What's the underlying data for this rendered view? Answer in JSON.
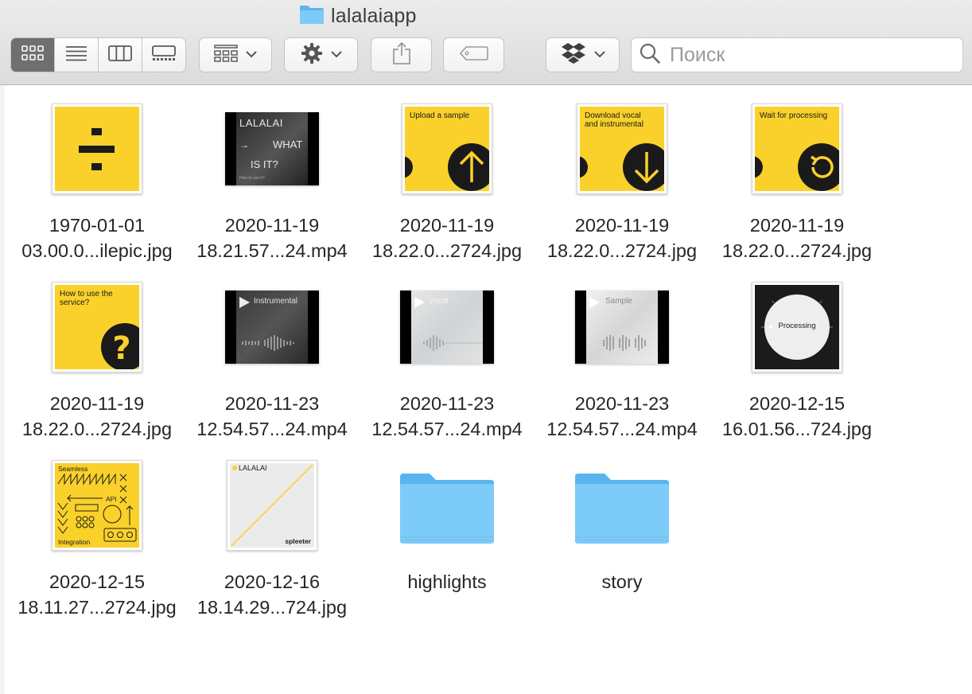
{
  "window": {
    "title": "lalalaiapp"
  },
  "toolbar": {
    "view_modes": [
      "icon-view",
      "list-view",
      "column-view",
      "gallery-view"
    ],
    "active_view": "icon-view",
    "search_placeholder": "Поиск"
  },
  "files": [
    {
      "line1": "1970-01-01",
      "line2": "03.00.0...ilepic.jpg",
      "kind": "divide"
    },
    {
      "line1": "2020-11-19",
      "line2": "18.21.57...24.mp4",
      "kind": "video-dark",
      "texts": [
        "LALALAI",
        "→",
        "WHAT",
        "IS IT?",
        "How to use it?"
      ]
    },
    {
      "line1": "2020-11-19",
      "line2": "18.22.0...2724.jpg",
      "kind": "upload",
      "caption": "Upload a sample"
    },
    {
      "line1": "2020-11-19",
      "line2": "18.22.0...2724.jpg",
      "kind": "download",
      "caption": "Download vocal and instrumental"
    },
    {
      "line1": "2020-11-19",
      "line2": "18.22.0...2724.jpg",
      "kind": "wait",
      "caption": "Wait for processing"
    },
    {
      "line1": "2020-11-19",
      "line2": "18.22.0...2724.jpg",
      "kind": "howto",
      "caption": "How to use the service?"
    },
    {
      "line1": "2020-11-23",
      "line2": "12.54.57...24.mp4",
      "kind": "video-instrumental",
      "caption": "Instrumental"
    },
    {
      "line1": "2020-11-23",
      "line2": "12.54.57...24.mp4",
      "kind": "video-vocal",
      "caption": "Vocal"
    },
    {
      "line1": "2020-11-23",
      "line2": "12.54.57...24.mp4",
      "kind": "video-sample",
      "caption": "Sample"
    },
    {
      "line1": "2020-12-15",
      "line2": "16.01.56...724.jpg",
      "kind": "processing",
      "caption": "Processing"
    },
    {
      "line1": "2020-12-15",
      "line2": "18.11.27...2724.jpg",
      "kind": "api",
      "texts": [
        "Seamless",
        "API",
        "Integration"
      ]
    },
    {
      "line1": "2020-12-16",
      "line2": "18.14.29...724.jpg",
      "kind": "spleeter",
      "texts": [
        "LALALAI",
        "spleeter"
      ]
    },
    {
      "line1": "highlights",
      "line2": "",
      "kind": "folder"
    },
    {
      "line1": "story",
      "line2": "",
      "kind": "folder"
    }
  ],
  "colors": {
    "accent_yellow": "#f9d12a",
    "folder_blue": "#69c3f7",
    "active_segment": "#6f6f6f"
  }
}
